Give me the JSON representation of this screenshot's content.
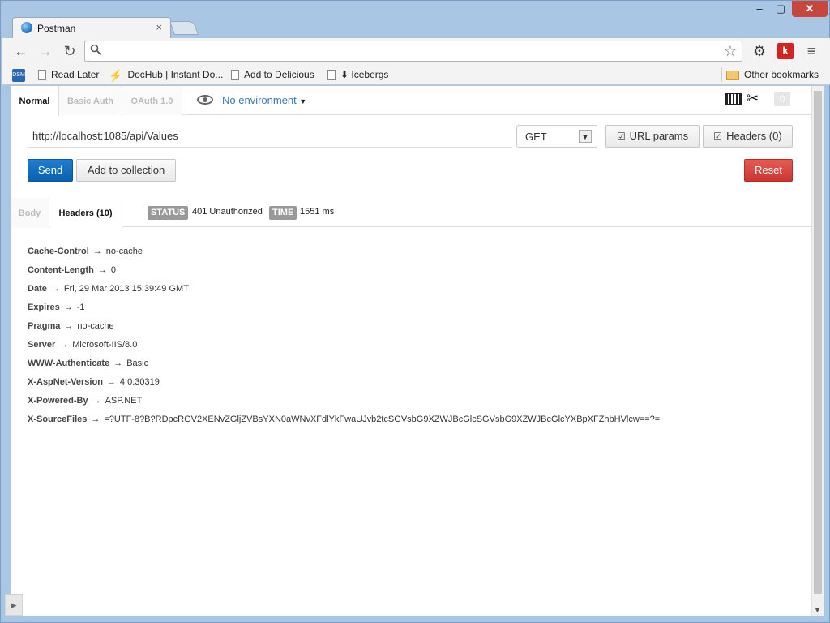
{
  "browser": {
    "tab_title": "Postman",
    "tab_close": "×",
    "window_controls": {
      "minimize": "‒",
      "maximize": "▢",
      "close": "✕"
    },
    "address": "",
    "k_extension_label": "k",
    "bookmarks": [
      {
        "label": "Read Later",
        "icon": "page-icon"
      },
      {
        "label": "DocHub | Instant Do...",
        "icon": "bolt-icon"
      },
      {
        "label": "Add to Delicious",
        "icon": "page-icon"
      },
      {
        "label": "⬇ Icebergs",
        "icon": "page-icon"
      }
    ],
    "other_bookmarks": "Other bookmarks",
    "dsm_label": "DSM"
  },
  "auth_tabs": {
    "normal": "Normal",
    "basic": "Basic Auth",
    "oauth": "OAuth 1.0"
  },
  "environment": {
    "label": "No environment"
  },
  "notification_count": "0",
  "request": {
    "url": "http://localhost:1085/api/Values",
    "method": "GET",
    "url_params_label": "URL params",
    "headers_label": "Headers (0)",
    "send_label": "Send",
    "add_collection_label": "Add to collection",
    "reset_label": "Reset"
  },
  "response": {
    "tabs": {
      "body": "Body",
      "headers": "Headers (10)"
    },
    "status_label": "STATUS",
    "status_value": "401 Unauthorized",
    "time_label": "TIME",
    "time_value": "1551 ms",
    "arrow": "→",
    "headers": [
      {
        "key": "Cache-Control",
        "value": "no-cache"
      },
      {
        "key": "Content-Length",
        "value": "0"
      },
      {
        "key": "Date",
        "value": "Fri, 29 Mar 2013 15:39:49 GMT"
      },
      {
        "key": "Expires",
        "value": "-1"
      },
      {
        "key": "Pragma",
        "value": "no-cache"
      },
      {
        "key": "Server",
        "value": "Microsoft-IIS/8.0"
      },
      {
        "key": "WWW-Authenticate",
        "value": "Basic"
      },
      {
        "key": "X-AspNet-Version",
        "value": "4.0.30319"
      },
      {
        "key": "X-Powered-By",
        "value": "ASP.NET"
      },
      {
        "key": "X-SourceFiles",
        "value": "=?UTF-8?B?RDpcRGV2XENvZGljZVBsYXN0aWNvXFdlYkFwaUJvb2tcSGVsbG9XZWJBcGlcSGVsbG9XZWJBcGlcYXBpXFZhbHVlcw==?="
      }
    ]
  }
}
